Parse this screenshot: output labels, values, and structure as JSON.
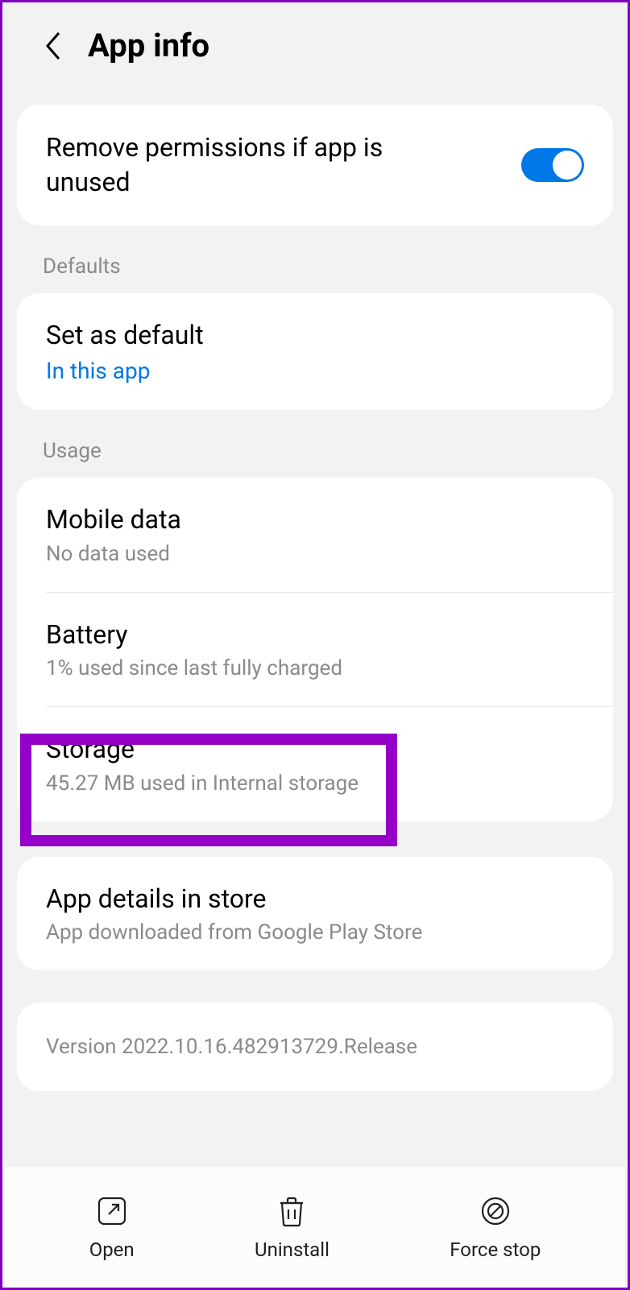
{
  "header": {
    "title": "App info"
  },
  "permissions": {
    "title": "Remove permissions if app is unused"
  },
  "sections": {
    "defaults_label": "Defaults",
    "usage_label": "Usage"
  },
  "defaults": {
    "title": "Set as default",
    "subtitle": "In this app"
  },
  "usage": {
    "mobile_data": {
      "title": "Mobile data",
      "subtitle": "No data used"
    },
    "battery": {
      "title": "Battery",
      "subtitle": "1% used since last fully charged"
    },
    "storage": {
      "title": "Storage",
      "subtitle": "45.27 MB used in Internal storage"
    }
  },
  "store": {
    "title": "App details in store",
    "subtitle": "App downloaded from Google Play Store"
  },
  "version": {
    "text": "Version 2022.10.16.482913729.Release"
  },
  "bottom": {
    "open": "Open",
    "uninstall": "Uninstall",
    "force_stop": "Force stop"
  }
}
